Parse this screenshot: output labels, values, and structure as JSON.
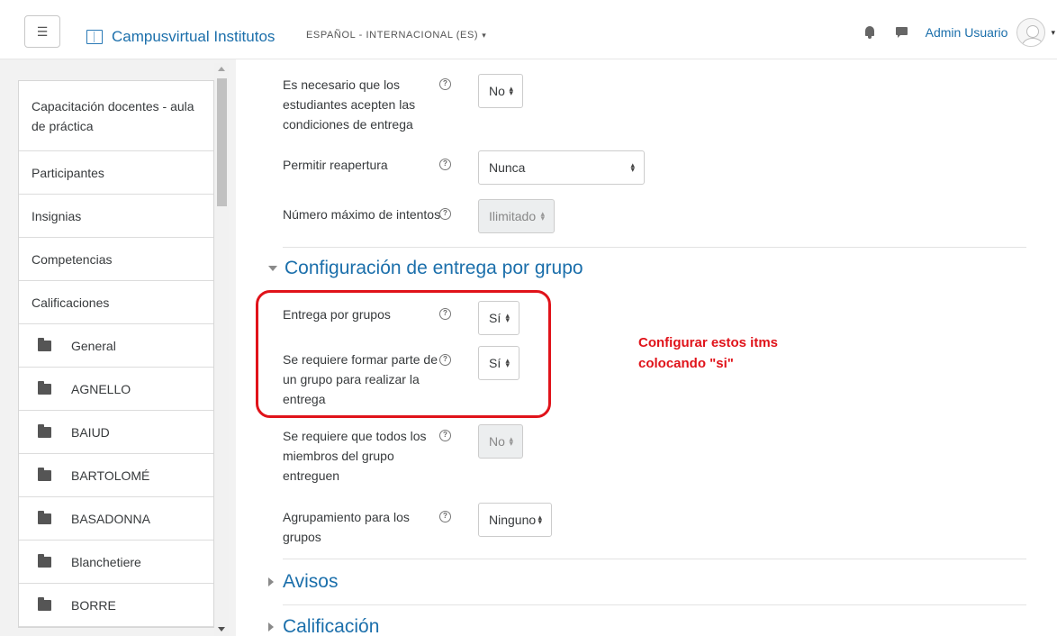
{
  "navbar": {
    "site_name": "Campusvirtual Institutos",
    "language": "ESPAÑOL - INTERNACIONAL (ES)",
    "user_name": "Admin Usuario"
  },
  "sidebar": {
    "items": [
      {
        "label": "Capacitación docentes - aula de práctica"
      },
      {
        "label": "Participantes"
      },
      {
        "label": "Insignias"
      },
      {
        "label": "Competencias"
      },
      {
        "label": "Calificaciones"
      },
      {
        "label": "General"
      },
      {
        "label": "AGNELLO"
      },
      {
        "label": "BAIUD"
      },
      {
        "label": "BARTOLOMÉ"
      },
      {
        "label": "BASADONNA"
      },
      {
        "label": "Blanchetiere"
      },
      {
        "label": "BORRE"
      }
    ]
  },
  "form": {
    "accept_conditions": {
      "label": "Es necesario que los estudiantes acepten las condiciones de entrega",
      "value": "No"
    },
    "reopen": {
      "label": "Permitir reapertura",
      "value": "Nunca"
    },
    "max_attempts": {
      "label": "Número máximo de intentos",
      "value": "Ilimitado"
    },
    "group_section_title": "Configuración de entrega por grupo",
    "group_submission": {
      "label": "Entrega por grupos",
      "value": "Sí"
    },
    "require_group": {
      "label": "Se requiere formar parte de un grupo para realizar la entrega",
      "value": "Sí"
    },
    "all_members": {
      "label": "Se requiere que todos los miembros del grupo entreguen",
      "value": "No"
    },
    "grouping": {
      "label": "Agrupamiento para los grupos",
      "value": "Ninguno"
    },
    "notices_title": "Avisos",
    "grade_title": "Calificación"
  },
  "annotation": {
    "text": "Configurar estos itms colocando \"si\"",
    "color": "#e0131a"
  },
  "colors": {
    "link": "#1b6fab",
    "highlight": "#e0131a"
  }
}
